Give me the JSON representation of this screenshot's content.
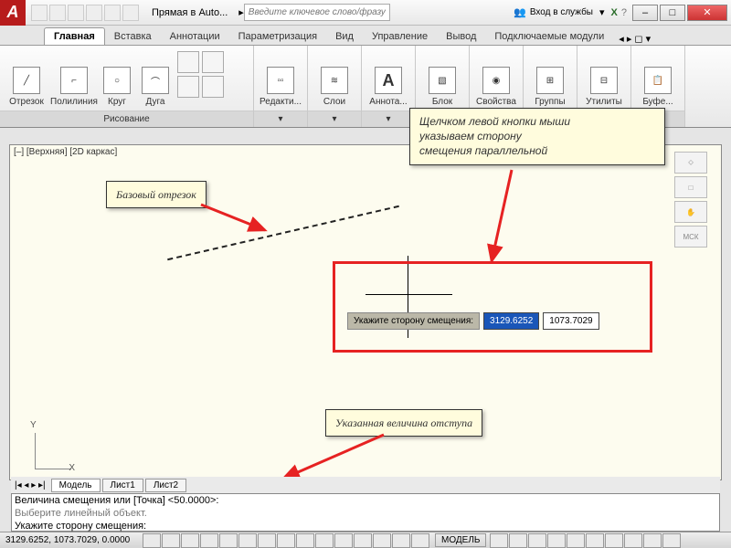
{
  "title": "Прямая в Auto...",
  "help_placeholder": "Введите ключевое слово/фразу",
  "signin": "Вход в службы",
  "tabs": [
    "Главная",
    "Вставка",
    "Аннотации",
    "Параметризация",
    "Вид",
    "Управление",
    "Вывод",
    "Подключаемые модули"
  ],
  "ribbon": {
    "draw_panel": "Рисование",
    "draw": {
      "line": "Отрезок",
      "pline": "Полилиния",
      "circle": "Круг",
      "arc": "Дуга"
    },
    "modify": "Редакти...",
    "layers": "Слои",
    "annot": "Аннота...",
    "block": "Блок",
    "props": "Свойства",
    "groups": "Группы",
    "utils": "Утилиты",
    "buf": "Буфе..."
  },
  "viewport_label": "[–] [Верхняя] [2D каркас]",
  "callout1": "Базовый отрезок",
  "callout2_l1": "Щелчком левой кнопки мыши",
  "callout2_l2": "указываем сторону",
  "callout2_l3": "смещения параллельной",
  "callout3": "Указанная величина отступа",
  "dyn_label": "Укажите сторону смещения:",
  "dyn_v1": "3129.6252",
  "dyn_v2": "1073.7029",
  "nav_wcs": "МСК",
  "layout": {
    "model": "Модель",
    "s1": "Лист1",
    "s2": "Лист2"
  },
  "cmd_l1": "Величина смещения или [Точка] <50.0000>:",
  "cmd_l2": "Выберите линейный объект.",
  "cmd_l3": "Укажите сторону смещения:",
  "status_coords": "3129.6252, 1073.7029, 0.0000",
  "status_model": "МОДЕЛЬ",
  "arrow_color": "#e62222"
}
